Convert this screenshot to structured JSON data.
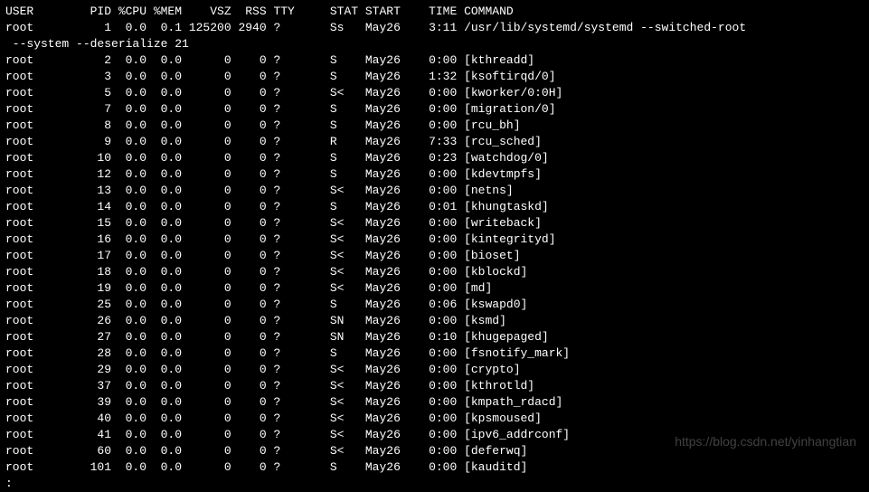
{
  "headers": {
    "user": "USER",
    "pid": "PID",
    "cpu": "%CPU",
    "mem": "%MEM",
    "vsz": "VSZ",
    "rss": "RSS",
    "tty": "TTY",
    "stat": "STAT",
    "start": "START",
    "time": "TIME",
    "command": "COMMAND"
  },
  "wrap_line": " --system --deserialize 21",
  "processes": [
    {
      "user": "root",
      "pid": "1",
      "cpu": "0.0",
      "mem": "0.1",
      "vsz": "125200",
      "rss": "2940",
      "tty": "?",
      "stat": "Ss",
      "start": "May26",
      "time": "3:11",
      "command": "/usr/lib/systemd/systemd --switched-root"
    },
    {
      "user": "root",
      "pid": "2",
      "cpu": "0.0",
      "mem": "0.0",
      "vsz": "0",
      "rss": "0",
      "tty": "?",
      "stat": "S",
      "start": "May26",
      "time": "0:00",
      "command": "[kthreadd]"
    },
    {
      "user": "root",
      "pid": "3",
      "cpu": "0.0",
      "mem": "0.0",
      "vsz": "0",
      "rss": "0",
      "tty": "?",
      "stat": "S",
      "start": "May26",
      "time": "1:32",
      "command": "[ksoftirqd/0]"
    },
    {
      "user": "root",
      "pid": "5",
      "cpu": "0.0",
      "mem": "0.0",
      "vsz": "0",
      "rss": "0",
      "tty": "?",
      "stat": "S<",
      "start": "May26",
      "time": "0:00",
      "command": "[kworker/0:0H]"
    },
    {
      "user": "root",
      "pid": "7",
      "cpu": "0.0",
      "mem": "0.0",
      "vsz": "0",
      "rss": "0",
      "tty": "?",
      "stat": "S",
      "start": "May26",
      "time": "0:00",
      "command": "[migration/0]"
    },
    {
      "user": "root",
      "pid": "8",
      "cpu": "0.0",
      "mem": "0.0",
      "vsz": "0",
      "rss": "0",
      "tty": "?",
      "stat": "S",
      "start": "May26",
      "time": "0:00",
      "command": "[rcu_bh]"
    },
    {
      "user": "root",
      "pid": "9",
      "cpu": "0.0",
      "mem": "0.0",
      "vsz": "0",
      "rss": "0",
      "tty": "?",
      "stat": "R",
      "start": "May26",
      "time": "7:33",
      "command": "[rcu_sched]"
    },
    {
      "user": "root",
      "pid": "10",
      "cpu": "0.0",
      "mem": "0.0",
      "vsz": "0",
      "rss": "0",
      "tty": "?",
      "stat": "S",
      "start": "May26",
      "time": "0:23",
      "command": "[watchdog/0]"
    },
    {
      "user": "root",
      "pid": "12",
      "cpu": "0.0",
      "mem": "0.0",
      "vsz": "0",
      "rss": "0",
      "tty": "?",
      "stat": "S",
      "start": "May26",
      "time": "0:00",
      "command": "[kdevtmpfs]"
    },
    {
      "user": "root",
      "pid": "13",
      "cpu": "0.0",
      "mem": "0.0",
      "vsz": "0",
      "rss": "0",
      "tty": "?",
      "stat": "S<",
      "start": "May26",
      "time": "0:00",
      "command": "[netns]"
    },
    {
      "user": "root",
      "pid": "14",
      "cpu": "0.0",
      "mem": "0.0",
      "vsz": "0",
      "rss": "0",
      "tty": "?",
      "stat": "S",
      "start": "May26",
      "time": "0:01",
      "command": "[khungtaskd]"
    },
    {
      "user": "root",
      "pid": "15",
      "cpu": "0.0",
      "mem": "0.0",
      "vsz": "0",
      "rss": "0",
      "tty": "?",
      "stat": "S<",
      "start": "May26",
      "time": "0:00",
      "command": "[writeback]"
    },
    {
      "user": "root",
      "pid": "16",
      "cpu": "0.0",
      "mem": "0.0",
      "vsz": "0",
      "rss": "0",
      "tty": "?",
      "stat": "S<",
      "start": "May26",
      "time": "0:00",
      "command": "[kintegrityd]"
    },
    {
      "user": "root",
      "pid": "17",
      "cpu": "0.0",
      "mem": "0.0",
      "vsz": "0",
      "rss": "0",
      "tty": "?",
      "stat": "S<",
      "start": "May26",
      "time": "0:00",
      "command": "[bioset]"
    },
    {
      "user": "root",
      "pid": "18",
      "cpu": "0.0",
      "mem": "0.0",
      "vsz": "0",
      "rss": "0",
      "tty": "?",
      "stat": "S<",
      "start": "May26",
      "time": "0:00",
      "command": "[kblockd]"
    },
    {
      "user": "root",
      "pid": "19",
      "cpu": "0.0",
      "mem": "0.0",
      "vsz": "0",
      "rss": "0",
      "tty": "?",
      "stat": "S<",
      "start": "May26",
      "time": "0:00",
      "command": "[md]"
    },
    {
      "user": "root",
      "pid": "25",
      "cpu": "0.0",
      "mem": "0.0",
      "vsz": "0",
      "rss": "0",
      "tty": "?",
      "stat": "S",
      "start": "May26",
      "time": "0:06",
      "command": "[kswapd0]"
    },
    {
      "user": "root",
      "pid": "26",
      "cpu": "0.0",
      "mem": "0.0",
      "vsz": "0",
      "rss": "0",
      "tty": "?",
      "stat": "SN",
      "start": "May26",
      "time": "0:00",
      "command": "[ksmd]"
    },
    {
      "user": "root",
      "pid": "27",
      "cpu": "0.0",
      "mem": "0.0",
      "vsz": "0",
      "rss": "0",
      "tty": "?",
      "stat": "SN",
      "start": "May26",
      "time": "0:10",
      "command": "[khugepaged]"
    },
    {
      "user": "root",
      "pid": "28",
      "cpu": "0.0",
      "mem": "0.0",
      "vsz": "0",
      "rss": "0",
      "tty": "?",
      "stat": "S",
      "start": "May26",
      "time": "0:00",
      "command": "[fsnotify_mark]"
    },
    {
      "user": "root",
      "pid": "29",
      "cpu": "0.0",
      "mem": "0.0",
      "vsz": "0",
      "rss": "0",
      "tty": "?",
      "stat": "S<",
      "start": "May26",
      "time": "0:00",
      "command": "[crypto]"
    },
    {
      "user": "root",
      "pid": "37",
      "cpu": "0.0",
      "mem": "0.0",
      "vsz": "0",
      "rss": "0",
      "tty": "?",
      "stat": "S<",
      "start": "May26",
      "time": "0:00",
      "command": "[kthrotld]"
    },
    {
      "user": "root",
      "pid": "39",
      "cpu": "0.0",
      "mem": "0.0",
      "vsz": "0",
      "rss": "0",
      "tty": "?",
      "stat": "S<",
      "start": "May26",
      "time": "0:00",
      "command": "[kmpath_rdacd]"
    },
    {
      "user": "root",
      "pid": "40",
      "cpu": "0.0",
      "mem": "0.0",
      "vsz": "0",
      "rss": "0",
      "tty": "?",
      "stat": "S<",
      "start": "May26",
      "time": "0:00",
      "command": "[kpsmoused]"
    },
    {
      "user": "root",
      "pid": "41",
      "cpu": "0.0",
      "mem": "0.0",
      "vsz": "0",
      "rss": "0",
      "tty": "?",
      "stat": "S<",
      "start": "May26",
      "time": "0:00",
      "command": "[ipv6_addrconf]"
    },
    {
      "user": "root",
      "pid": "60",
      "cpu": "0.0",
      "mem": "0.0",
      "vsz": "0",
      "rss": "0",
      "tty": "?",
      "stat": "S<",
      "start": "May26",
      "time": "0:00",
      "command": "[deferwq]"
    },
    {
      "user": "root",
      "pid": "101",
      "cpu": "0.0",
      "mem": "0.0",
      "vsz": "0",
      "rss": "0",
      "tty": "?",
      "stat": "S",
      "start": "May26",
      "time": "0:00",
      "command": "[kauditd]"
    }
  ],
  "prompt": ":",
  "watermark": "https://blog.csdn.net/yinhangtian"
}
